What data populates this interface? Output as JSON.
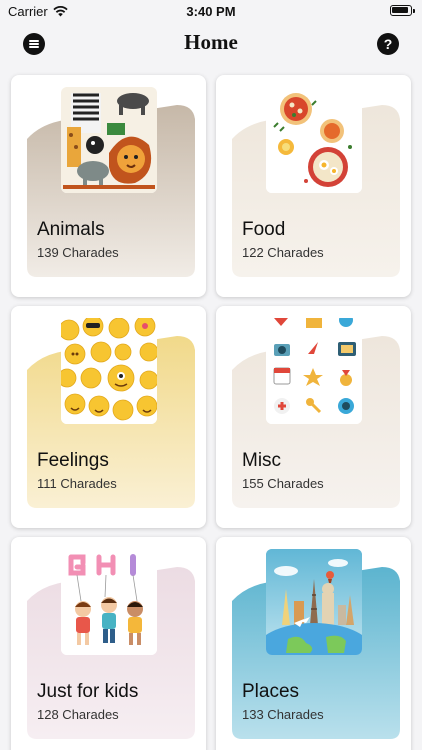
{
  "status_bar": {
    "carrier": "Carrier",
    "time": "3:40 PM"
  },
  "nav": {
    "title": "Home",
    "help_symbol": "?"
  },
  "categories": [
    {
      "title": "Animals",
      "count": "139 Charades",
      "icon": "animals-illustration",
      "accent": "#c6b8a8"
    },
    {
      "title": "Food",
      "count": "122 Charades",
      "icon": "food-illustration",
      "accent": "#eee6db"
    },
    {
      "title": "Feelings",
      "count": "111 Charades",
      "icon": "emoji-illustration",
      "accent": "#f1d98a"
    },
    {
      "title": "Misc",
      "count": "155 Charades",
      "icon": "misc-icons-illustration",
      "accent": "#eee6dc"
    },
    {
      "title": "Just for kids",
      "count": "128 Charades",
      "icon": "kids-illustration",
      "accent": "#ecdce3"
    },
    {
      "title": "Places",
      "count": "133 Charades",
      "icon": "places-illustration",
      "accent": "#7ec3d8"
    }
  ]
}
